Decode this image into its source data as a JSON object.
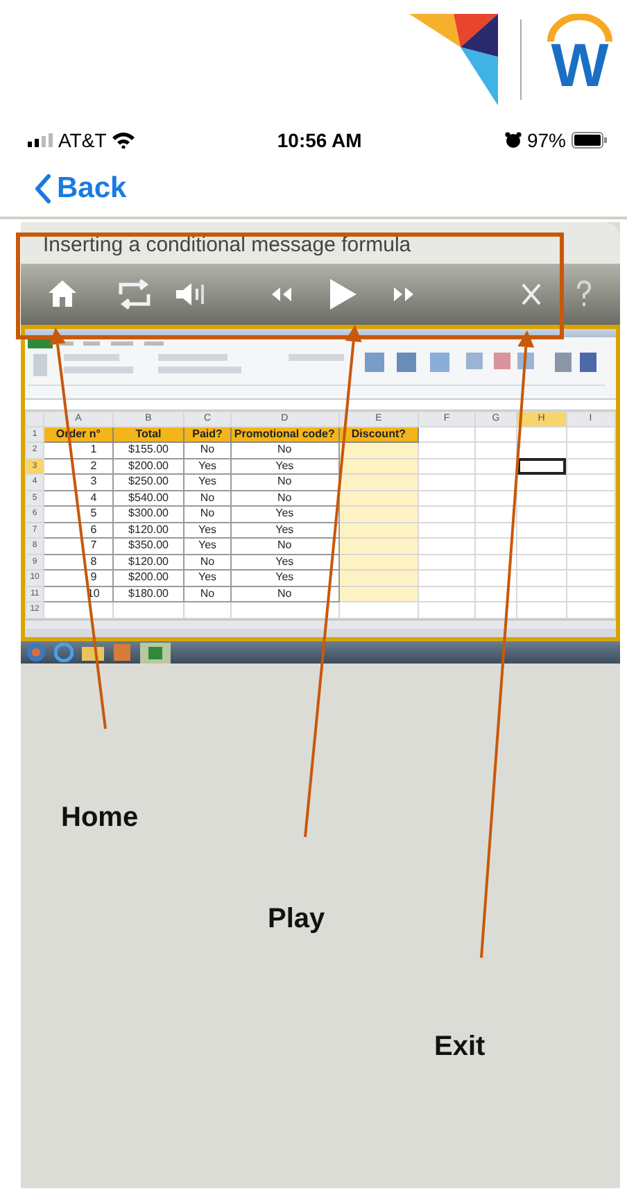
{
  "header": {
    "brand_letter": "W"
  },
  "status_bar": {
    "carrier": "AT&T",
    "time": "10:56 AM",
    "battery": "97%"
  },
  "nav": {
    "back": "Back"
  },
  "player": {
    "title": "Inserting a conditional message formula",
    "controls": [
      {
        "kind": "home"
      },
      {
        "kind": "repeat"
      },
      {
        "kind": "volume"
      },
      {
        "kind": "rewind"
      },
      {
        "kind": "play"
      },
      {
        "kind": "forward"
      },
      {
        "kind": "close"
      },
      {
        "kind": "help"
      }
    ]
  },
  "spreadsheet": {
    "column_letters": [
      {
        "label": "A",
        "selected": false
      },
      {
        "label": "B",
        "selected": false
      },
      {
        "label": "C",
        "selected": false
      },
      {
        "label": "D",
        "selected": false
      },
      {
        "label": "E",
        "selected": false
      },
      {
        "label": "F",
        "selected": false
      },
      {
        "label": "G",
        "selected": false
      },
      {
        "label": "H",
        "selected": true
      },
      {
        "label": "I",
        "selected": false
      }
    ],
    "header_row": {
      "number": "1",
      "cells": [
        "Order n°",
        "Total",
        "Paid?",
        "Promotional code?",
        "Discount?"
      ]
    },
    "rows": [
      {
        "number": "2",
        "selected": false,
        "cells": [
          "1",
          "$155.00",
          "No",
          "No"
        ]
      },
      {
        "number": "3",
        "selected": true,
        "cells": [
          "2",
          "$200.00",
          "Yes",
          "Yes"
        ]
      },
      {
        "number": "4",
        "selected": false,
        "cells": [
          "3",
          "$250.00",
          "Yes",
          "No"
        ]
      },
      {
        "number": "5",
        "selected": false,
        "cells": [
          "4",
          "$540.00",
          "No",
          "No"
        ]
      },
      {
        "number": "6",
        "selected": false,
        "cells": [
          "5",
          "$300.00",
          "No",
          "Yes"
        ]
      },
      {
        "number": "7",
        "selected": false,
        "cells": [
          "6",
          "$120.00",
          "Yes",
          "Yes"
        ]
      },
      {
        "number": "8",
        "selected": false,
        "cells": [
          "7",
          "$350.00",
          "Yes",
          "No"
        ]
      },
      {
        "number": "9",
        "selected": false,
        "cells": [
          "8",
          "$120.00",
          "No",
          "Yes"
        ]
      },
      {
        "number": "10",
        "selected": false,
        "cells": [
          "9",
          "$200.00",
          "Yes",
          "Yes"
        ]
      },
      {
        "number": "11",
        "selected": false,
        "cells": [
          "10",
          "$180.00",
          "No",
          "No"
        ]
      }
    ],
    "empty_row": "12"
  },
  "annotations": [
    {
      "label": "Home"
    },
    {
      "label": "Play"
    },
    {
      "label": "Exit"
    }
  ]
}
